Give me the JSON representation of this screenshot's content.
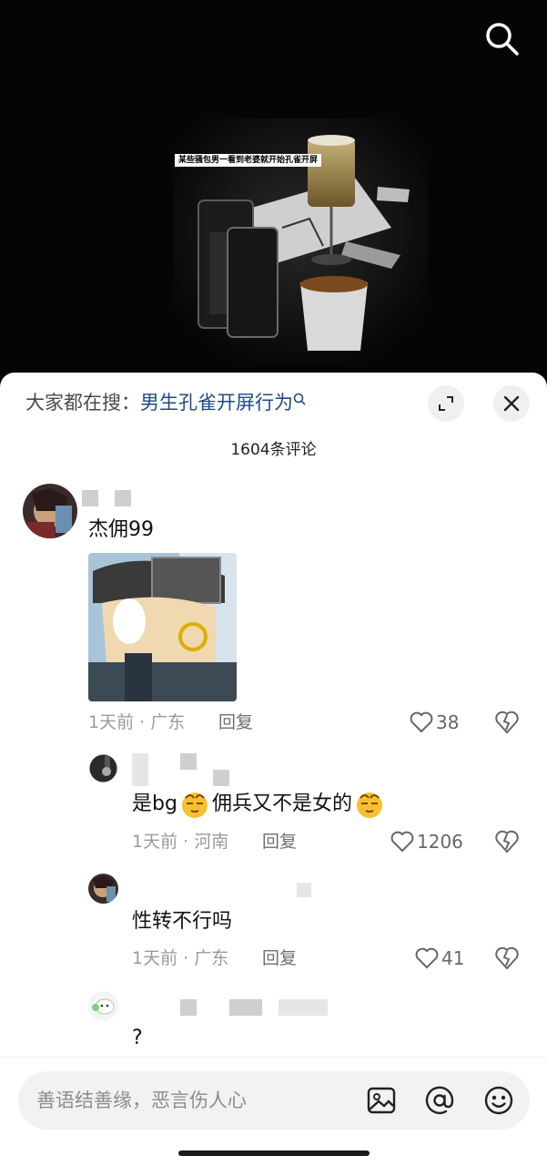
{
  "video": {
    "caption": "某些骚包男一看到老婆就开始孔雀开屏",
    "search_icon": "search-icon"
  },
  "header": {
    "search_prefix": "大家都在搜：",
    "search_term": "男生孔雀开屏行为",
    "comment_count": "1604条评论"
  },
  "comments": [
    {
      "text": "杰佣99",
      "location": "1天前 · 广东",
      "reply_label": "回复",
      "likes": "38",
      "has_sticker": true
    },
    {
      "text_part1": "是bg",
      "text_part2": "佣兵又不是女的",
      "location": "1天前 · 河南",
      "reply_label": "回复",
      "likes": "1206"
    },
    {
      "text": "性转不行吗",
      "location": "1天前 · 广东",
      "reply_label": "回复",
      "likes": "41"
    },
    {
      "text": "?"
    }
  ],
  "input": {
    "placeholder": "善语结善缘，恶言伤人心"
  },
  "colors": {
    "link": "#1f4a86",
    "muted": "#9a9a9a",
    "sheet_bg": "#ffffff"
  }
}
